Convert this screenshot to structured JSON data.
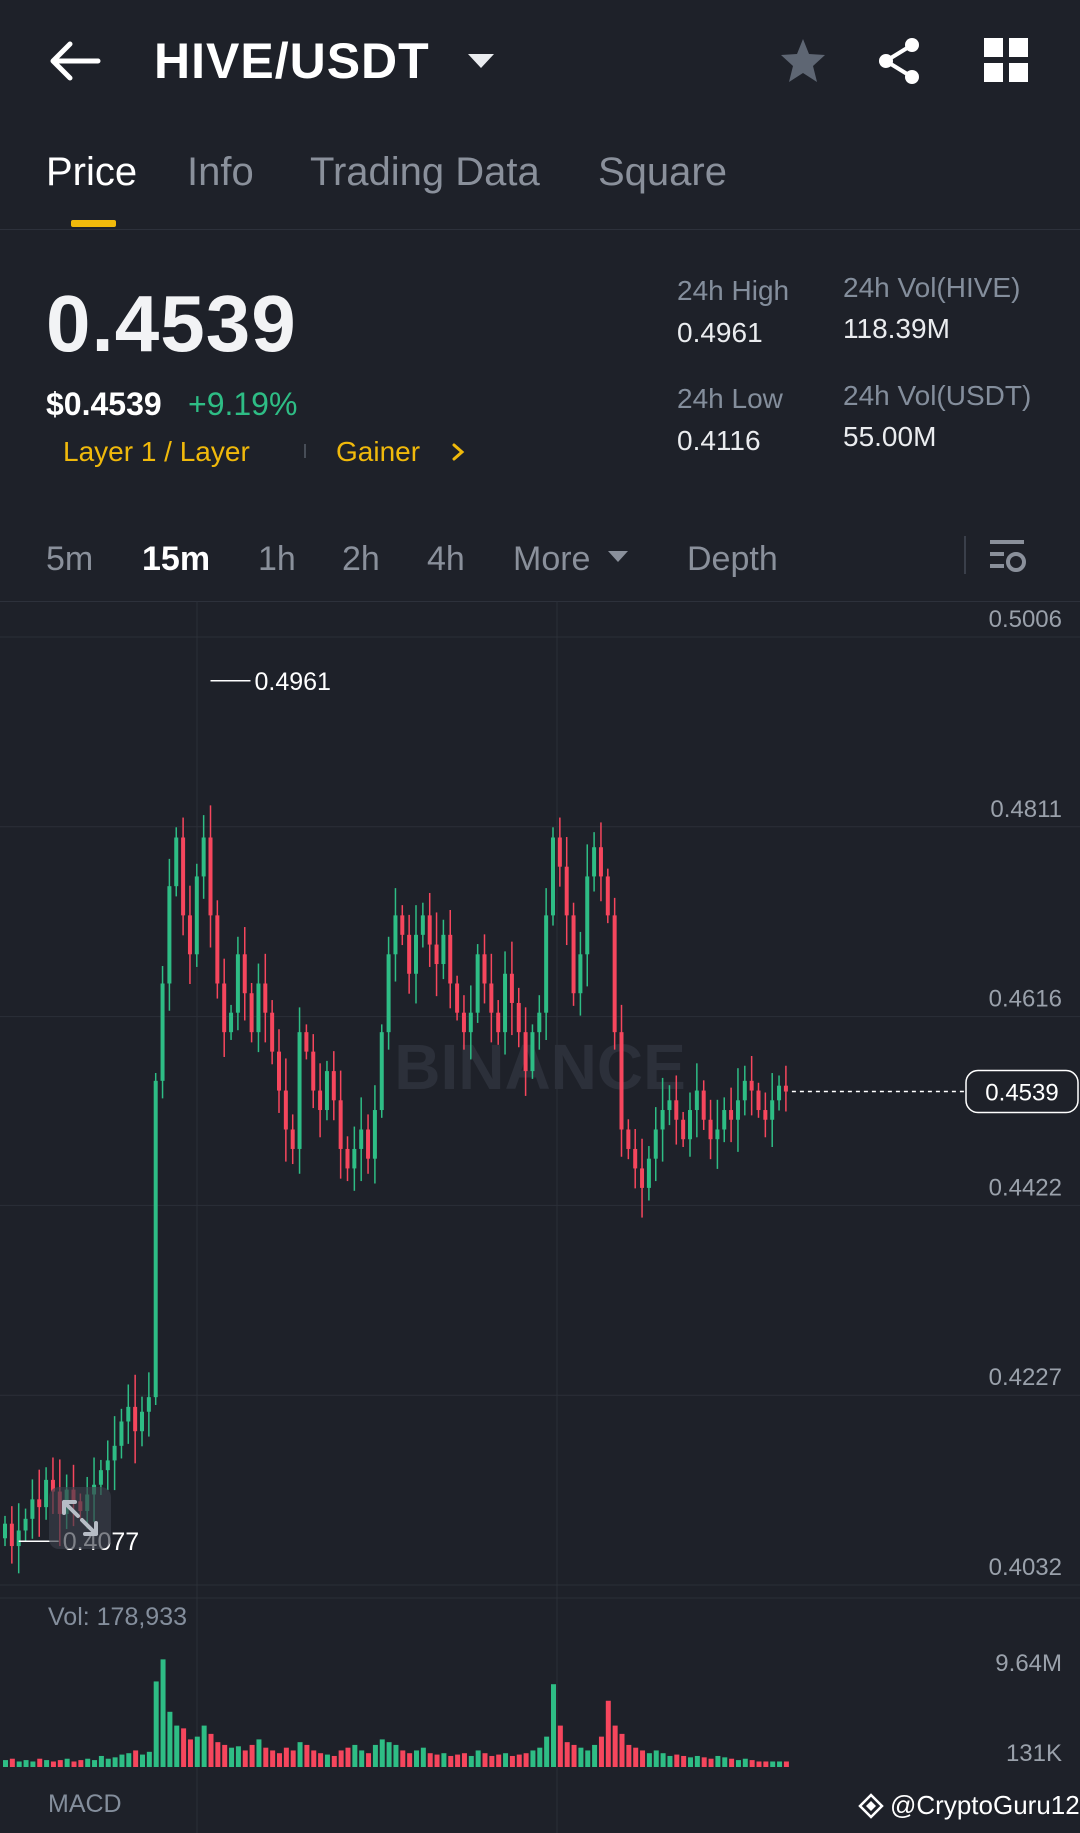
{
  "header": {
    "pair": "HIVE/USDT",
    "icons": [
      "back-arrow-icon",
      "caret-down-icon",
      "star-icon",
      "share-icon",
      "grid-icon"
    ]
  },
  "tabs": [
    {
      "label": "Price",
      "active": true
    },
    {
      "label": "Info",
      "active": false
    },
    {
      "label": "Trading Data",
      "active": false
    },
    {
      "label": "Square",
      "active": false
    }
  ],
  "ticker": {
    "last_price": "0.4539",
    "usd_price": "$0.4539",
    "change_pct": "+9.19%",
    "tag_category": "Layer 1 / Layer",
    "tag_gainer": "Gainer",
    "high_label": "24h High",
    "high_value": "0.4961",
    "low_label": "24h Low",
    "low_value": "0.4116",
    "vol_base_label": "24h Vol(HIVE)",
    "vol_base_value": "118.39M",
    "vol_quote_label": "24h Vol(USDT)",
    "vol_quote_value": "55.00M"
  },
  "intervals": [
    {
      "label": "5m",
      "active": false
    },
    {
      "label": "15m",
      "active": true
    },
    {
      "label": "1h",
      "active": false
    },
    {
      "label": "2h",
      "active": false
    },
    {
      "label": "4h",
      "active": false
    },
    {
      "label": "More",
      "active": false
    },
    {
      "label": "Depth",
      "active": false
    }
  ],
  "colors": {
    "up": "#2ebd85",
    "down": "#f6465d",
    "accent": "#f0b90b",
    "background": "#1e2129"
  },
  "chart": {
    "vol_label": "Vol: 178,933",
    "indicator_label": "MACD",
    "watermark": "@CryptoGuru12",
    "chart_logo_text": "BINANCE"
  },
  "chart_data": {
    "type": "candlestick",
    "interval": "15m",
    "y_ticks": [
      "0.5006",
      "0.4811",
      "0.4616",
      "0.4422",
      "0.4227",
      "0.4032"
    ],
    "ylim": [
      0.4032,
      0.5006
    ],
    "high_marker": "0.4961",
    "low_marker": "0.4077",
    "current_price_label": "0.4539",
    "volume_ticks": [
      "9.64M",
      "131K"
    ],
    "closes": [
      0.4095,
      0.4072,
      0.4088,
      0.41,
      0.412,
      0.4112,
      0.414,
      0.4128,
      0.4105,
      0.413,
      0.4118,
      0.4108,
      0.4125,
      0.4135,
      0.415,
      0.416,
      0.4175,
      0.42,
      0.4215,
      0.419,
      0.421,
      0.4225,
      0.455,
      0.465,
      0.475,
      0.48,
      0.472,
      0.468,
      0.476,
      0.48,
      0.472,
      0.465,
      0.46,
      0.462,
      0.468,
      0.464,
      0.46,
      0.465,
      0.462,
      0.458,
      0.454,
      0.45,
      0.448,
      0.46,
      0.458,
      0.454,
      0.452,
      0.456,
      0.453,
      0.448,
      0.446,
      0.448,
      0.45,
      0.447,
      0.452,
      0.46,
      0.468,
      0.472,
      0.47,
      0.466,
      0.47,
      0.472,
      0.469,
      0.467,
      0.47,
      0.465,
      0.462,
      0.46,
      0.462,
      0.468,
      0.465,
      0.462,
      0.46,
      0.466,
      0.463,
      0.46,
      0.456,
      0.46,
      0.462,
      0.472,
      0.48,
      0.477,
      0.472,
      0.464,
      0.468,
      0.476,
      0.479,
      0.476,
      0.472,
      0.46,
      0.45,
      0.448,
      0.446,
      0.444,
      0.447,
      0.45,
      0.452,
      0.453,
      0.451,
      0.449,
      0.452,
      0.454,
      0.451,
      0.449,
      0.45,
      0.452,
      0.451,
      0.453,
      0.455,
      0.454,
      0.452,
      0.451,
      0.453,
      0.4545,
      0.4539
    ],
    "volumes_rel": [
      0.05,
      0.06,
      0.04,
      0.05,
      0.04,
      0.06,
      0.05,
      0.04,
      0.05,
      0.06,
      0.04,
      0.05,
      0.06,
      0.05,
      0.08,
      0.06,
      0.07,
      0.09,
      0.1,
      0.12,
      0.09,
      0.11,
      0.62,
      0.78,
      0.4,
      0.3,
      0.28,
      0.2,
      0.22,
      0.3,
      0.24,
      0.18,
      0.16,
      0.14,
      0.15,
      0.12,
      0.16,
      0.2,
      0.14,
      0.12,
      0.1,
      0.14,
      0.12,
      0.18,
      0.16,
      0.12,
      0.1,
      0.09,
      0.08,
      0.12,
      0.14,
      0.16,
      0.12,
      0.1,
      0.16,
      0.2,
      0.18,
      0.16,
      0.12,
      0.1,
      0.12,
      0.14,
      0.1,
      0.09,
      0.1,
      0.08,
      0.09,
      0.1,
      0.08,
      0.12,
      0.1,
      0.08,
      0.09,
      0.1,
      0.08,
      0.09,
      0.1,
      0.12,
      0.14,
      0.22,
      0.6,
      0.3,
      0.18,
      0.16,
      0.14,
      0.12,
      0.16,
      0.22,
      0.48,
      0.3,
      0.24,
      0.16,
      0.14,
      0.12,
      0.1,
      0.12,
      0.1,
      0.08,
      0.09,
      0.08,
      0.07,
      0.08,
      0.07,
      0.06,
      0.08,
      0.07,
      0.06,
      0.05,
      0.06,
      0.05,
      0.04,
      0.04,
      0.04,
      0.04,
      0.04
    ]
  }
}
